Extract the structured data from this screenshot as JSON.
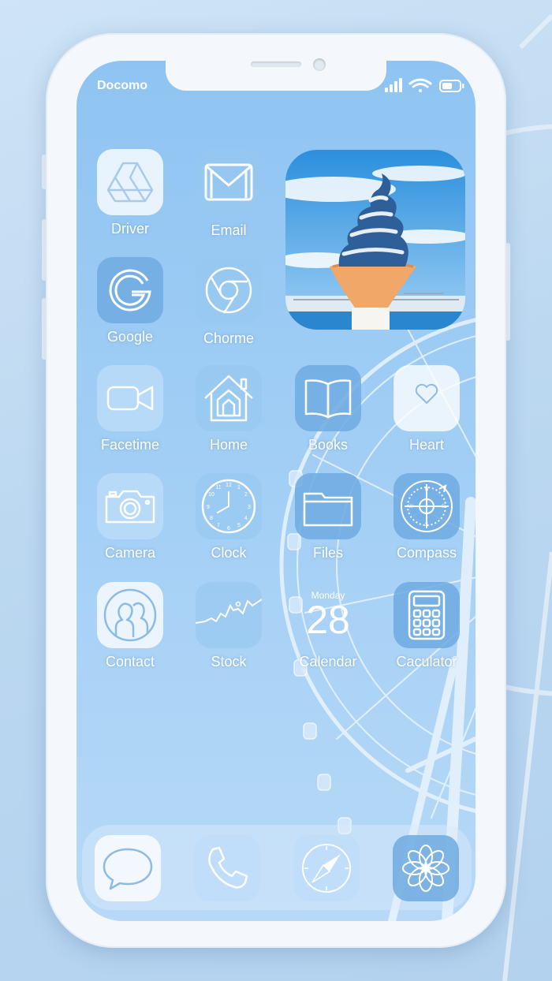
{
  "status_bar": {
    "carrier": "Docomo"
  },
  "apps": {
    "driver": "Driver",
    "email": "Email",
    "google": "Google",
    "chrome": "Chorme",
    "facetime": "Facetime",
    "home": "Home",
    "books": "Books",
    "heart": "Heart",
    "camera": "Camera",
    "clock": "Clock",
    "files": "Files",
    "compass": "Compass",
    "contact": "Contact",
    "stock": "Stock",
    "calendar": "Calendar",
    "calculator": "Caculator"
  },
  "calendar_widget": {
    "weekday": "Monday",
    "day": "28"
  },
  "dock": [
    "messages-icon",
    "phone-icon",
    "safari-icon",
    "photos-icon"
  ],
  "colors": {
    "wallpaper": "#a3cff5",
    "label": "#ffffff",
    "frame": "#f4f8fc"
  }
}
